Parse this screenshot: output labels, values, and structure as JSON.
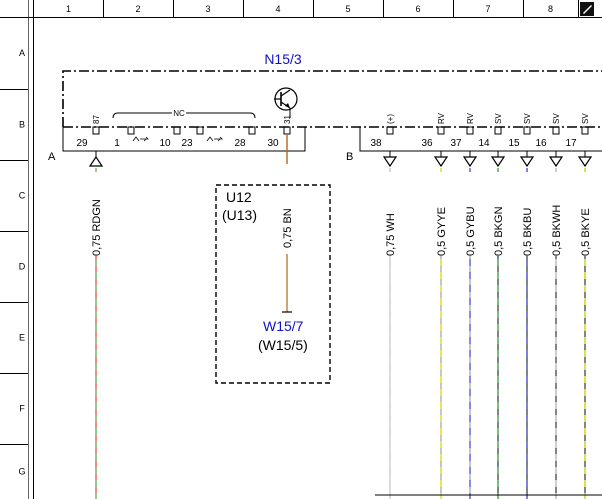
{
  "frame": {
    "columns": [
      "1",
      "2",
      "3",
      "4",
      "5",
      "6",
      "7",
      "8"
    ],
    "rows": [
      "A",
      "B",
      "C",
      "D",
      "E",
      "F",
      "G"
    ]
  },
  "module": {
    "title": "N15/3",
    "connector_a": "A",
    "connector_b": "B",
    "nc_label": "NC"
  },
  "conn_a_pins": [
    "29",
    "1",
    "10",
    "23",
    "28",
    "30"
  ],
  "conn_b_pins": [
    "38",
    "36",
    "37",
    "14",
    "15",
    "16",
    "17"
  ],
  "top_pin_labels": [
    "87",
    "31"
  ],
  "top_b_labels": [
    "(+)",
    "RV",
    "RV",
    "SV",
    "SV",
    "SV",
    "SV"
  ],
  "wires": [
    {
      "label": "0,75 RDGN",
      "color_a": "#e24040",
      "color_b": "#5cb85c"
    },
    {
      "label": "0,75 BN",
      "color_a": "#b5651d",
      "color_b": "#b5651d"
    },
    {
      "label": "0,75 WH",
      "color_a": "#c8c8c8",
      "color_b": "#c8c8c8"
    },
    {
      "label": "0,5 GYYE",
      "color_a": "#a0a0a0",
      "color_b": "#e8e000"
    },
    {
      "label": "0,5 GYBU",
      "color_a": "#a0a0a0",
      "color_b": "#4a4ad8"
    },
    {
      "label": "0,5 BKGN",
      "color_a": "#333333",
      "color_b": "#3cb043"
    },
    {
      "label": "0,5 BKBU",
      "color_a": "#333333",
      "color_b": "#4a4ad8"
    },
    {
      "label": "0,5 BKWH",
      "color_a": "#333333",
      "color_b": "#c8c8c8"
    },
    {
      "label": "0,5 BKYE",
      "color_a": "#333333",
      "color_b": "#e8e000"
    }
  ],
  "box": {
    "name1": "U12",
    "name2": "(U13)"
  },
  "target": {
    "name1": "W15/7",
    "name2": "(W15/5)"
  },
  "colors": {
    "accent_blue": "#1010c8",
    "line": "#000000"
  }
}
